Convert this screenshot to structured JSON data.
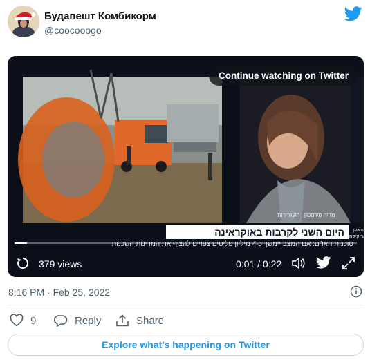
{
  "author": {
    "name": "Будапешт Комбикорм",
    "handle": "@coocooogo",
    "avatar": "avatar-santa-hat"
  },
  "logo": "twitter-bird-icon",
  "video": {
    "continue_label": "Continue watching on Twitter",
    "caption_headline": "היום השני לקרבות באוקראינה",
    "caption_sub": "סוכנות האו\"ם: אם המצב יימשך כ-4 מיליון פליטים צפויים להציף את המדינות השכנות",
    "caption_name": "מריה פירסטון | השגרירות",
    "caption_side": "פלחאוגן בארוקיקה",
    "views": "379 views",
    "time": "0:01 / 0:22",
    "progress": 0.036
  },
  "meta": {
    "timestamp": "8:16 PM · Feb 25, 2022"
  },
  "actions": {
    "likes": "9",
    "reply": "Reply",
    "share": "Share"
  },
  "explore": "Explore what's happening on Twitter",
  "colors": {
    "brand": "#1d9bf0",
    "secondary_text": "#536471",
    "border": "#cfd9de"
  }
}
